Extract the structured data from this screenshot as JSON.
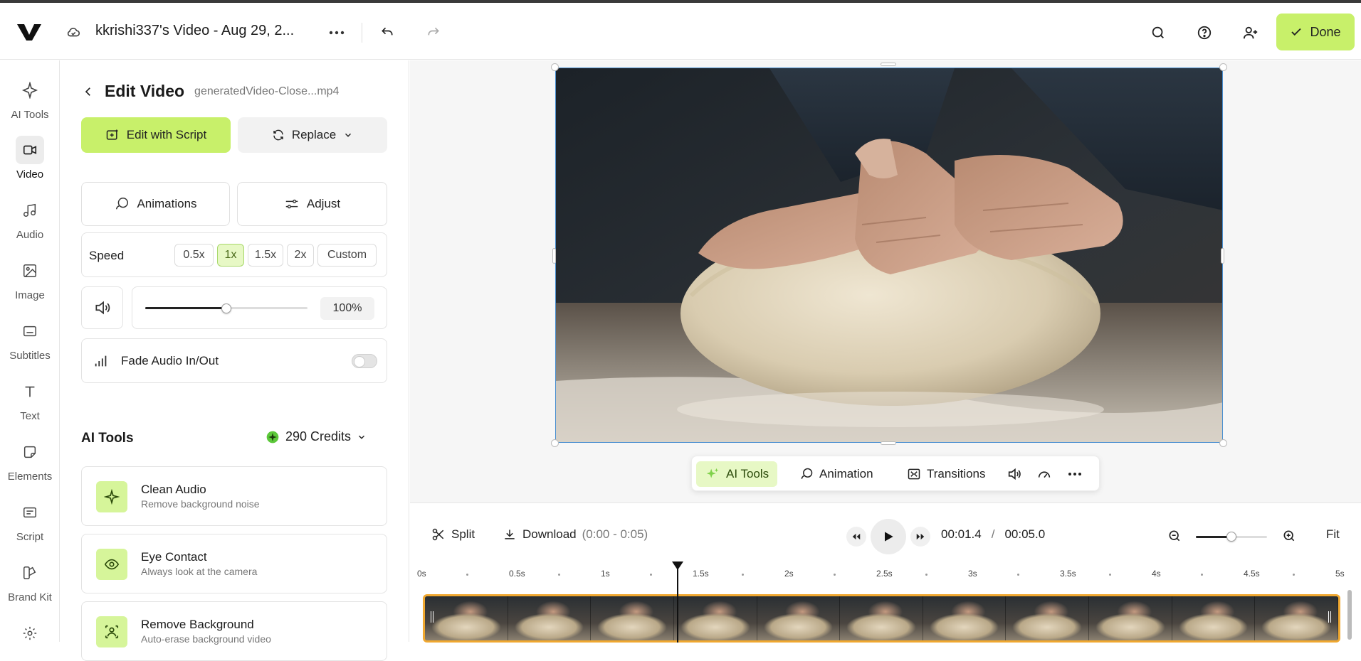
{
  "header": {
    "project_title": "kkrishi337's Video - Aug 29, 2...",
    "done_label": "Done"
  },
  "rail": {
    "items": [
      {
        "label": "AI Tools",
        "icon": "sparkle-icon"
      },
      {
        "label": "Video",
        "icon": "video-icon",
        "active": true
      },
      {
        "label": "Audio",
        "icon": "music-note-icon"
      },
      {
        "label": "Image",
        "icon": "image-icon"
      },
      {
        "label": "Subtitles",
        "icon": "subtitles-icon"
      },
      {
        "label": "Text",
        "icon": "text-icon"
      },
      {
        "label": "Elements",
        "icon": "elements-icon"
      },
      {
        "label": "Script",
        "icon": "script-icon"
      },
      {
        "label": "Brand Kit",
        "icon": "brand-kit-icon"
      }
    ]
  },
  "panel": {
    "title": "Edit Video",
    "filename": "generatedVideo-Close...mp4",
    "edit_script_label": "Edit with Script",
    "replace_label": "Replace",
    "animations_label": "Animations",
    "adjust_label": "Adjust",
    "speed": {
      "label": "Speed",
      "options": [
        "0.5x",
        "1x",
        "1.5x",
        "2x",
        "Custom"
      ],
      "selected": "1x"
    },
    "volume": {
      "value_text": "100%",
      "level": 0.5
    },
    "fade_label": "Fade Audio In/Out",
    "fade_enabled": false,
    "ai_tools_title": "AI Tools",
    "credits_label": "290 Credits",
    "tools": [
      {
        "name": "Clean Audio",
        "desc": "Remove background noise",
        "icon": "sparkle-icon"
      },
      {
        "name": "Eye Contact",
        "desc": "Always look at the camera",
        "icon": "eye-icon"
      },
      {
        "name": "Remove Background",
        "desc": "Auto-erase background video",
        "icon": "person-cutout-icon"
      }
    ]
  },
  "floatbar": {
    "ai_tools_label": "AI Tools",
    "animation_label": "Animation",
    "transitions_label": "Transitions"
  },
  "timeline": {
    "split_label": "Split",
    "download_label": "Download",
    "range_label": "(0:00 - 0:05)",
    "current_time": "00:01.4",
    "separator": "/",
    "total_time": "00:05.0",
    "fit_label": "Fit",
    "zoom_level": 0.5,
    "ruler_labels": [
      "0s",
      "0.5s",
      "1s",
      "1.5s",
      "2s",
      "2.5s",
      "3s",
      "3.5s",
      "4s",
      "4.5s",
      "5s"
    ],
    "playhead_seconds": 1.4
  },
  "colors": {
    "accent_green": "#c8f06a",
    "clip_border": "#f0a830",
    "selection_blue": "#4a8fd0"
  }
}
